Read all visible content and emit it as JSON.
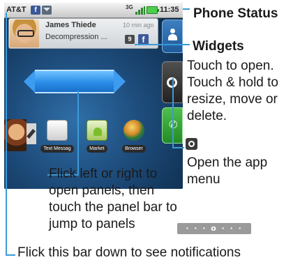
{
  "status_bar": {
    "carrier": "AT&T",
    "notification_icons": [
      "facebook-icon",
      "mail-icon"
    ],
    "network": "3G",
    "time": "11:35"
  },
  "contact_widget": {
    "name": "James Thiede",
    "time_ago": "10 min ago",
    "status": "Decompression ...",
    "count": "9",
    "network_badge": "f"
  },
  "dock": [
    "contacts-icon",
    "app-menu-icon",
    "phone-icon"
  ],
  "apps": [
    {
      "label": "Text Messag",
      "icon": "text-messaging-icon"
    },
    {
      "label": "Market",
      "icon": "market-icon"
    },
    {
      "label": "Browser",
      "icon": "browser-icon"
    }
  ],
  "callouts": {
    "phone_status": "Phone Status",
    "widgets_title": "Widgets",
    "widgets_desc": "Touch to open. Touch & hold to resize, move or delete.",
    "app_menu_desc": "Open the app menu",
    "flick_panels_desc": "Flick left or right to open panels, then touch the panel bar to jump to panels",
    "panel_indicator": "· · · o · · ·",
    "notifications_desc": "Flick this bar down to see notifications"
  },
  "colors": {
    "callout_line": "#3b9ad9",
    "facebook": "#3b5998",
    "panel_bar": "#2a8de8",
    "phone_button": "#2f9e2f"
  }
}
